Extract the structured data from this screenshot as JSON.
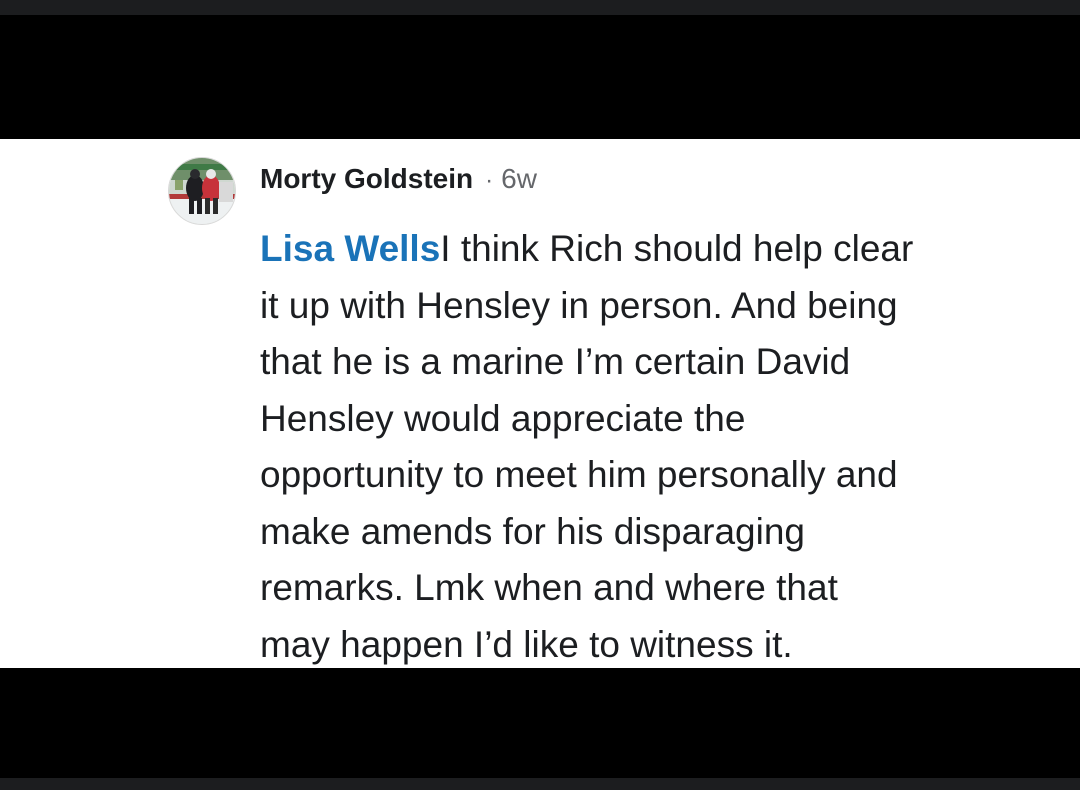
{
  "colors": {
    "background_bar": "#000000",
    "edge_strip": "#1c1d1f",
    "panel": "#ffffff",
    "text": "#1c1e21",
    "muted": "#65676b",
    "mention": "#1a73b8"
  },
  "comment": {
    "author": "Morty Goldstein",
    "separator": "·",
    "timestamp": "6w",
    "avatar_icon": "hockey-player-avatar",
    "mention": "Lisa Wells",
    "lines": [
      "I think Rich should help clear",
      "it up with Hensley in person. And being",
      "that he is a marine I’m certain David",
      "Hensley would appreciate the",
      "opportunity to meet him personally and",
      "make amends for his disparaging",
      "remarks. Lmk when and where that",
      "may happen I’d like to witness it."
    ]
  }
}
